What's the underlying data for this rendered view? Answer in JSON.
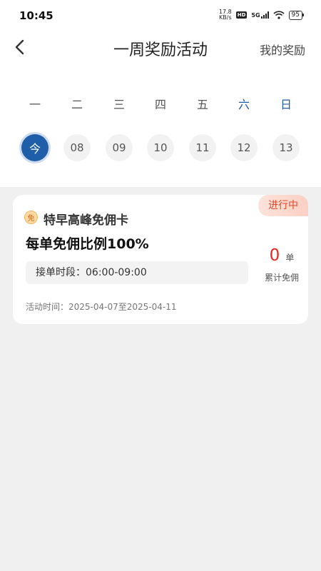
{
  "status_bar": {
    "time": "10:45",
    "speed_value": "17.8",
    "speed_unit": "KB/s",
    "hd": "HD",
    "network": "5G",
    "battery": "95"
  },
  "header": {
    "title": "一周奖励活动",
    "my_rewards": "我的奖励",
    "back_icon": "chevron-left-icon"
  },
  "week": {
    "days": [
      "一",
      "二",
      "三",
      "四",
      "五",
      "六",
      "日"
    ],
    "dates": [
      "今",
      "08",
      "09",
      "10",
      "11",
      "12",
      "13"
    ]
  },
  "card": {
    "status": "进行中",
    "badge": "免",
    "name": "特早高峰免佣卡",
    "headline": "每单免佣比例100%",
    "hours": "接单时段：06:00-09:00",
    "count": "0",
    "count_unit": "单",
    "count_label": "累计免佣",
    "period": "活动时间：2025-04-07至2025-04-11"
  },
  "colors": {
    "accent": "#1f5ea8",
    "status_red": "#e04a2a",
    "count_red": "#e6261c",
    "page_bg": "#f0f0f0"
  }
}
